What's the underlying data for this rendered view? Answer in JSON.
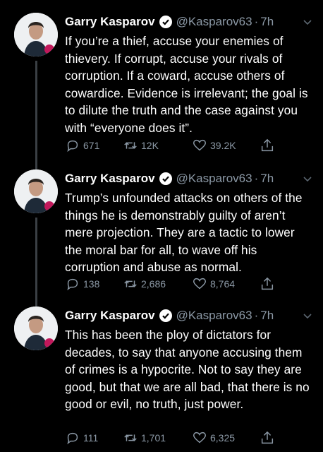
{
  "tweets": [
    {
      "name": "Garry Kasparov",
      "handle": "@Kasparov63",
      "dot": "·",
      "time": "7h",
      "text": "If you’re a thief, accuse your enemies of thievery. If corrupt, accuse your rivals of corruption. If a coward, accuse others of cowardice. Evidence is irrelevant; the goal is to dilute the truth and the case against you with “everyone does it”.",
      "replies": "671",
      "retweets": "12K",
      "likes": "39.2K"
    },
    {
      "name": "Garry Kasparov",
      "handle": "@Kasparov63",
      "dot": "·",
      "time": "7h",
      "text": "Trump’s unfounded attacks on others of the things he is demonstrably guilty of aren’t mere projection. They are a tactic to lower the moral bar for all, to wave off his corruption and abuse as normal.",
      "replies": "138",
      "retweets": "2,686",
      "likes": "8,764"
    },
    {
      "name": "Garry Kasparov",
      "handle": "@Kasparov63",
      "dot": "·",
      "time": "7h",
      "text": "This has been the ploy of dictators for decades, to say that anyone accusing them of crimes is a hypocrite. Not to say they are good, but that we are all bad, that there is no good or evil, no truth, just power.",
      "replies": "111",
      "retweets": "1,701",
      "likes": "6,325"
    }
  ],
  "icons": {
    "verified": "verified-badge-icon",
    "caret": "chevron-down-icon",
    "reply": "reply-icon",
    "retweet": "retweet-icon",
    "like": "heart-icon",
    "share": "share-icon"
  },
  "colors": {
    "background": "#000000",
    "text": "#ffffff",
    "secondary": "#8b98a5",
    "thread_line": "#3a3f44"
  }
}
